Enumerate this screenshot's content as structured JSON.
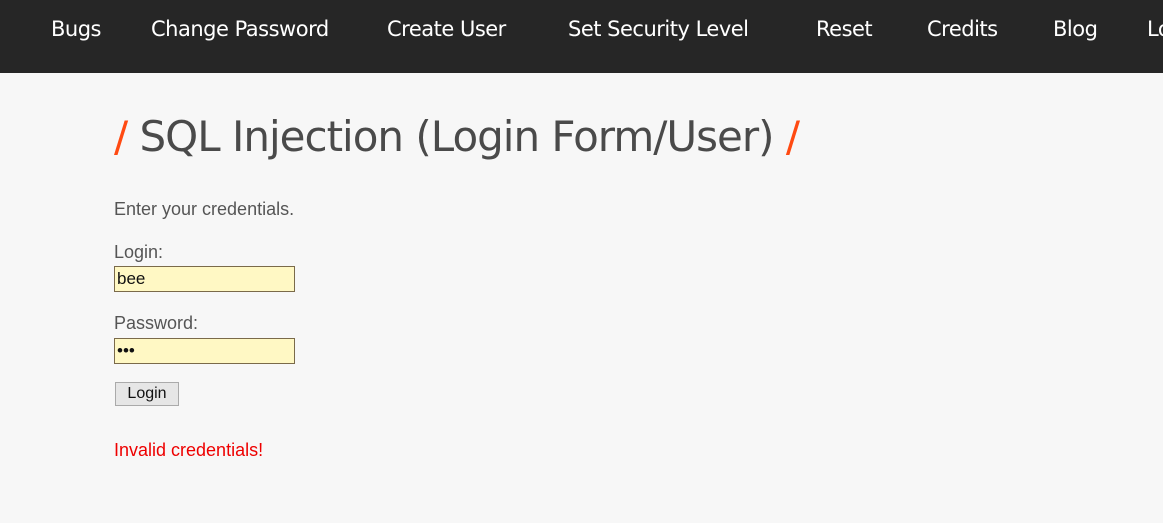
{
  "nav": {
    "items": [
      {
        "label": "Bugs"
      },
      {
        "label": "Change Password"
      },
      {
        "label": "Create User"
      },
      {
        "label": "Set Security Level"
      },
      {
        "label": "Reset"
      },
      {
        "label": "Credits"
      },
      {
        "label": "Blog"
      },
      {
        "label": "Logout"
      }
    ]
  },
  "page": {
    "title": "SQL Injection (Login Form/User)",
    "title_slash": "/",
    "intro": "Enter your credentials."
  },
  "form": {
    "login_label": "Login:",
    "login_value": "bee",
    "password_label": "Password:",
    "password_value": "bug",
    "submit_label": "Login"
  },
  "message": {
    "text": "Invalid credentials!",
    "color": "#ee0000"
  },
  "colors": {
    "accent": "#ff4a12",
    "nav_bg": "#262626",
    "input_bg": "#fff8c4"
  }
}
